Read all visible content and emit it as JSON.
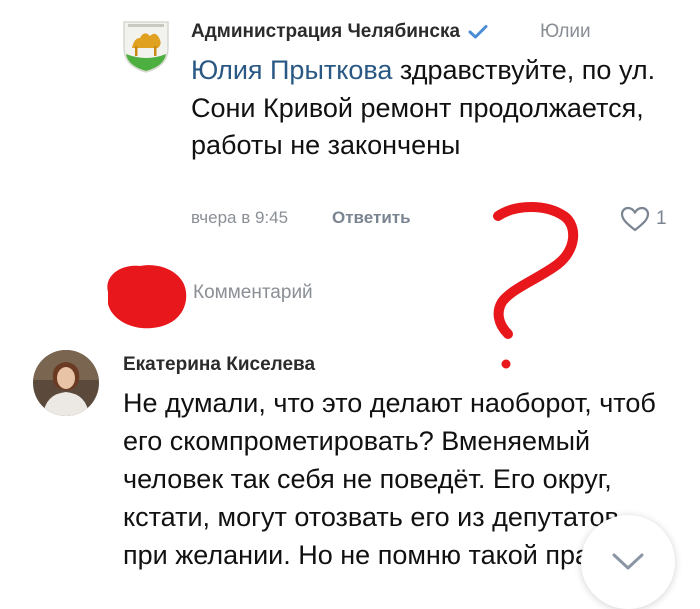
{
  "admin_comment": {
    "author": "Администрация Челябинска",
    "reply_to": "Юлии",
    "mention": "Юлия Прыткова",
    "text": " здравствуйте, по ул. Сони Кривой ремонт продолжается, работы не закончены",
    "time": "вчера в 9:45",
    "answer_label": "Ответить",
    "likes": "1"
  },
  "comment_input": {
    "placeholder": "Комментарий"
  },
  "user_comment": {
    "author": "Екатерина Киселева",
    "text": "Не думали, что это делают наоборот, чтоб его скомпрометировать? Вменяемый человек так себя не поведёт. Его округ, кстати, могут отозвать его из депутатов, при желании. Но не помню такой практики"
  },
  "colors": {
    "link": "#2a5885",
    "secondary_text": "#8a8f96",
    "accent_red": "#e8171b",
    "verified_blue": "#4a8bd6"
  },
  "icons": {
    "verified": "check-mark",
    "like": "heart-outline",
    "scroll_down": "chevron-down"
  }
}
